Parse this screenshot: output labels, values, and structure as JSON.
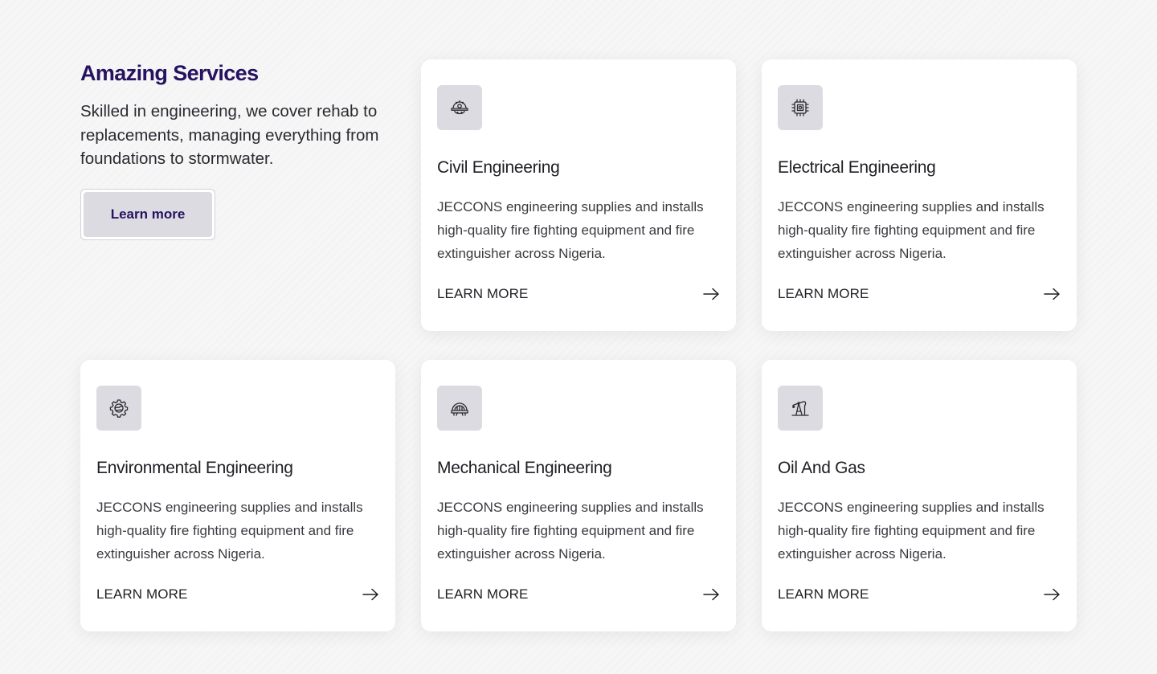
{
  "intro": {
    "title": "Amazing Services",
    "description": "Skilled in engineering, we cover rehab to replacements, managing everything from foundations to stormwater.",
    "button_label": "Learn more"
  },
  "services": [
    {
      "title": "Civil Engineering",
      "description": "JECCONS engineering supplies and installs high-quality fire fighting equipment and fire extinguisher across Nigeria.",
      "link_label": "LEARN MORE",
      "icon": "hard-hat-gear-icon"
    },
    {
      "title": "Electrical Engineering",
      "description": "JECCONS engineering supplies and installs high-quality fire fighting equipment and fire extinguisher across Nigeria.",
      "link_label": "LEARN MORE",
      "icon": "circuit-chip-icon"
    },
    {
      "title": "Environmental Engineering",
      "description": "JECCONS engineering supplies and installs high-quality fire fighting equipment and fire extinguisher across Nigeria.",
      "link_label": "LEARN MORE",
      "icon": "eco-gear-icon"
    },
    {
      "title": "Mechanical Engineering",
      "description": "JECCONS engineering supplies and installs high-quality fire fighting equipment and fire extinguisher across Nigeria.",
      "link_label": "LEARN MORE",
      "icon": "turbine-machine-icon"
    },
    {
      "title": "Oil And Gas",
      "description": "JECCONS engineering supplies and installs high-quality fire fighting equipment and fire extinguisher across Nigeria.",
      "link_label": "LEARN MORE",
      "icon": "oil-pump-jack-icon"
    }
  ],
  "colors": {
    "brand": "#26125f",
    "icon_tile": "#dcdbe2",
    "card_bg": "#ffffff",
    "text": "#1f1f24"
  }
}
